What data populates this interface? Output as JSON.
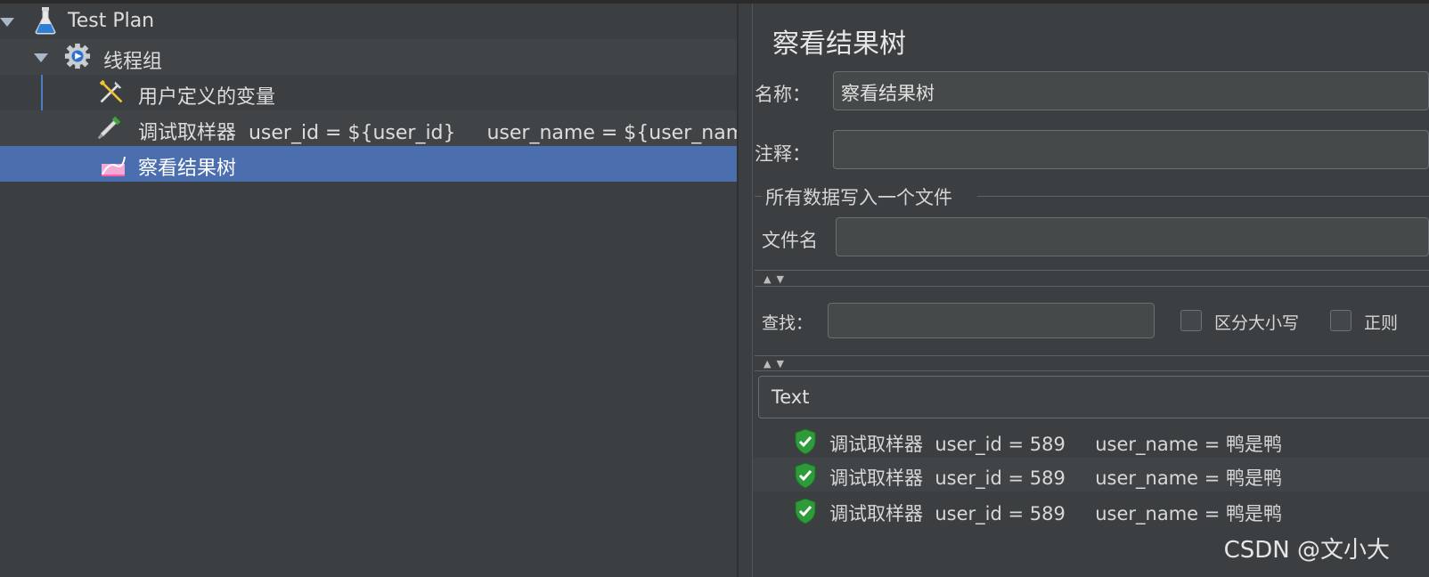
{
  "tree": {
    "items": [
      {
        "label": "Test Plan",
        "icon": "flask-icon"
      },
      {
        "label": "线程组",
        "icon": "gear-icon"
      },
      {
        "label": "用户定义的变量",
        "icon": "tools-icon"
      },
      {
        "label": "调试取样器  user_id = ${user_id}     user_name = ${user_name}",
        "icon": "dropper-icon"
      },
      {
        "label": "察看结果树",
        "icon": "chart-icon"
      }
    ]
  },
  "panel": {
    "title": "察看结果树",
    "name_label": "名称：",
    "name_value": "察看结果树",
    "comment_label": "注释：",
    "comment_value": "",
    "file_group_title": "所有数据写入一个文件",
    "filename_label": "文件名",
    "filename_value": "",
    "search_label": "查找：",
    "search_value": "",
    "case_sensitive_label": "区分大小写",
    "regex_label": "正则",
    "renderer_value": "Text",
    "results": [
      {
        "label": "调试取样器  user_id = 589     user_name = 鸭是鸭",
        "status": "success"
      },
      {
        "label": "调试取样器  user_id = 589     user_name = 鸭是鸭",
        "status": "success"
      },
      {
        "label": "调试取样器  user_id = 589     user_name = 鸭是鸭",
        "status": "success"
      }
    ]
  },
  "watermark": "CSDN @文小大",
  "colors": {
    "background": "#3c3f41",
    "selection": "#4b6eaf",
    "success": "#2e9b3a"
  }
}
